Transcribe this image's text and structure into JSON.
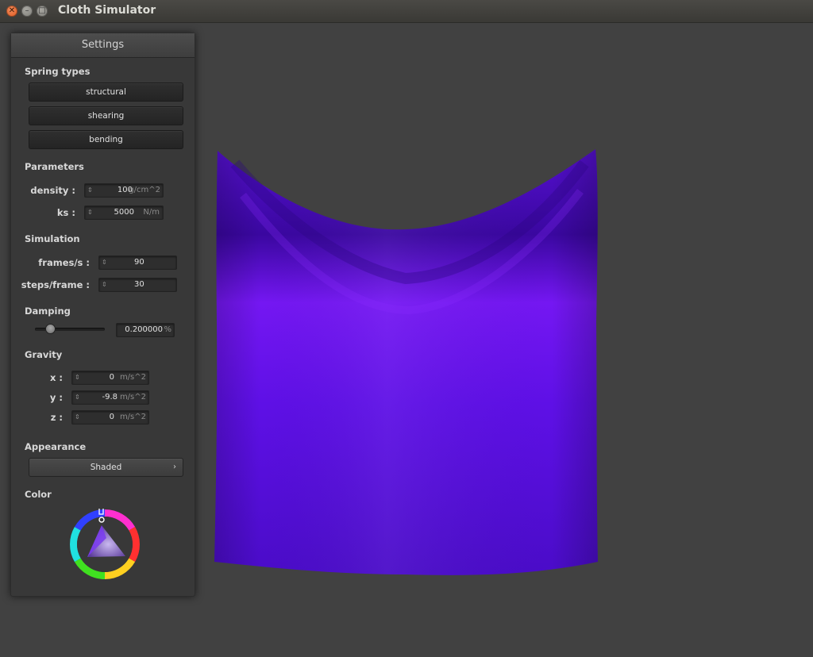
{
  "window": {
    "title": "Cloth Simulator"
  },
  "panel": {
    "header": "Settings",
    "spring_types": {
      "title": "Spring types",
      "buttons": [
        "structural",
        "shearing",
        "bending"
      ]
    },
    "parameters": {
      "title": "Parameters",
      "density": {
        "label": "density :",
        "value": "100",
        "unit": "g/cm^2"
      },
      "ks": {
        "label": "ks :",
        "value": "5000",
        "unit": "N/m"
      }
    },
    "simulation": {
      "title": "Simulation",
      "fps": {
        "label": "frames/s :",
        "value": "90"
      },
      "steps": {
        "label": "steps/frame :",
        "value": "30"
      }
    },
    "damping": {
      "title": "Damping",
      "value": "0.200000",
      "unit": "%",
      "slider_fraction": 0.2
    },
    "gravity": {
      "title": "Gravity",
      "x": {
        "label": "x :",
        "value": "0",
        "unit": "m/s^2"
      },
      "y": {
        "label": "y :",
        "value": "-9.8",
        "unit": "m/s^2"
      },
      "z": {
        "label": "z :",
        "value": "0",
        "unit": "m/s^2"
      }
    },
    "appearance": {
      "title": "Appearance",
      "selected": "Shaded"
    },
    "color": {
      "title": "Color",
      "value": "#6a12f0"
    }
  },
  "colors": {
    "cloth": "#6a12f0",
    "background": "#414141"
  },
  "icons": {
    "close": "close-icon",
    "minimize": "minimize-icon",
    "maximize": "maximize-icon",
    "spinner": "spinner-icon",
    "chevron": "chevron-right-icon"
  }
}
